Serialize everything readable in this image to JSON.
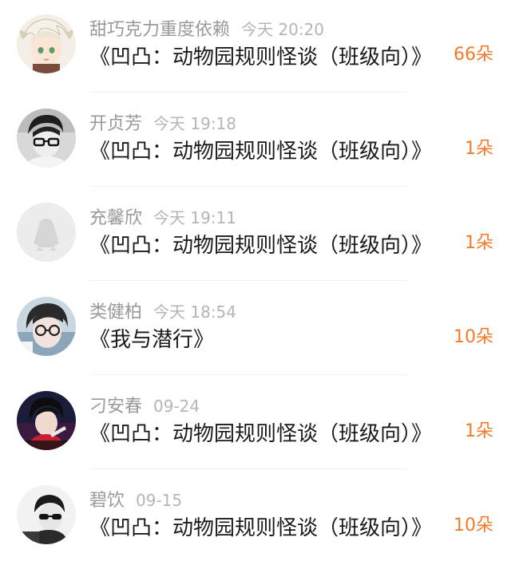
{
  "gifts": [
    {
      "name": "甜巧克力重度依赖",
      "time": "今天 20:20",
      "title": "《凹凸：动物园规则怪谈（班级向）》",
      "count": "66朵",
      "avatar": "anime-character-avatar"
    },
    {
      "name": "开贞芳",
      "time": "今天 19:18",
      "title": "《凹凸：动物园规则怪谈（班级向）》",
      "count": "1朵",
      "avatar": "glasses-person-avatar"
    },
    {
      "name": "充馨欣",
      "time": "今天 19:11",
      "title": "《凹凸：动物园规则怪谈（班级向）》",
      "count": "1朵",
      "avatar": "default-penguin-avatar"
    },
    {
      "name": "类健柏",
      "time": "今天 18:54",
      "title": "《我与潜行》",
      "count": "10朵",
      "avatar": "glasses-selfie-avatar"
    },
    {
      "name": "刁安春",
      "time": "09-24",
      "title": "《凹凸：动物园规则怪谈（班级向）》",
      "count": "1朵",
      "avatar": "dark-illustration-avatar"
    },
    {
      "name": "碧饮",
      "time": "09-15",
      "title": "《凹凸：动物园规则怪谈（班级向）》",
      "count": "10朵",
      "avatar": "sunglasses-person-avatar"
    }
  ],
  "colors": {
    "count": "#f27a2a",
    "name": "#999999",
    "time": "#b5b5b5",
    "title": "#1a1a1a"
  }
}
